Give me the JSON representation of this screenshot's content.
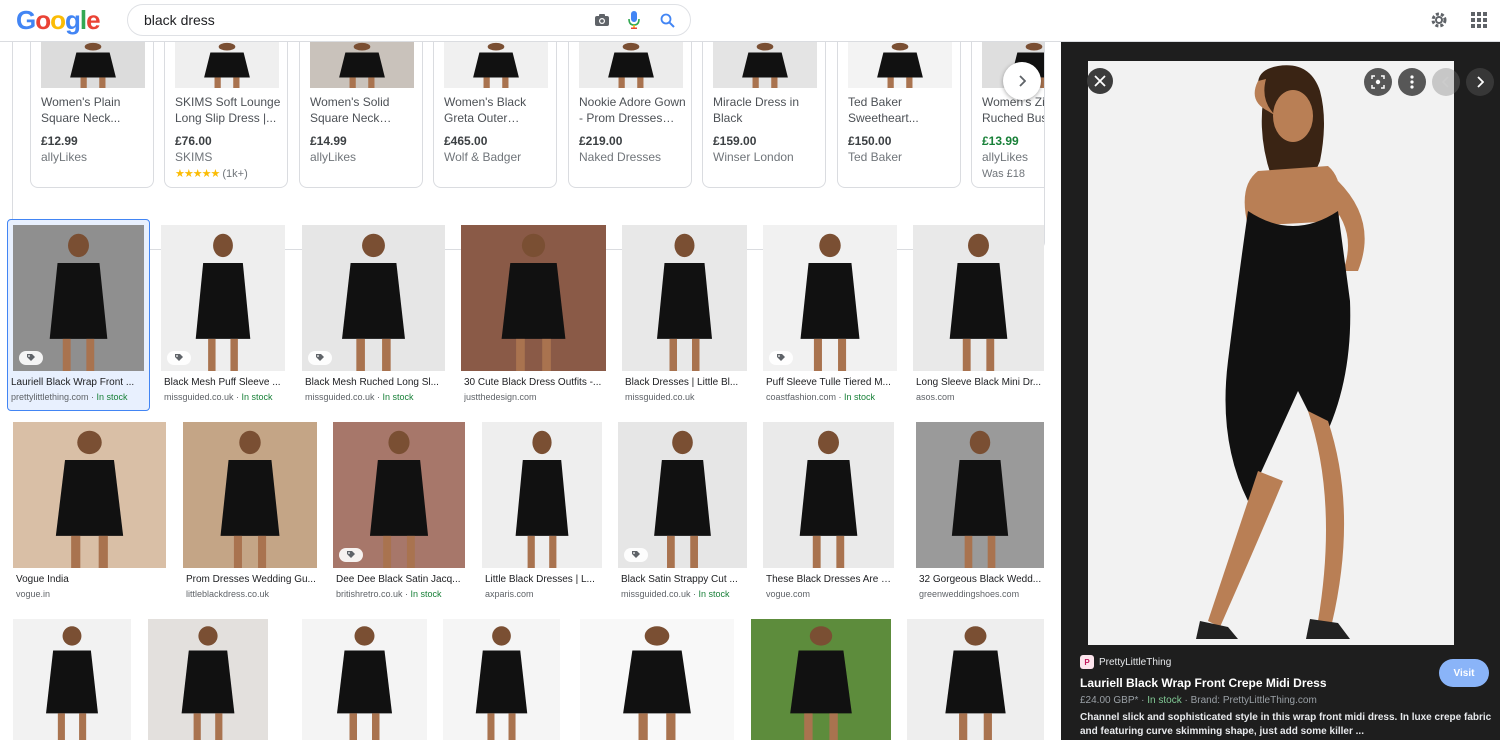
{
  "header": {
    "logo_letters": [
      {
        "ch": "G",
        "color": "#4285f4"
      },
      {
        "ch": "o",
        "color": "#ea4335"
      },
      {
        "ch": "o",
        "color": "#fbbc05"
      },
      {
        "ch": "g",
        "color": "#4285f4"
      },
      {
        "ch": "l",
        "color": "#34a853"
      },
      {
        "ch": "e",
        "color": "#ea4335"
      }
    ],
    "search_value": "black dress",
    "icons": [
      "camera-icon",
      "microphone-icon",
      "search-icon",
      "gear-icon",
      "apps-grid-icon"
    ]
  },
  "shopping": [
    {
      "title": "Women's Plain Square Neck...",
      "price": "£12.99",
      "seller": "allyLikes",
      "img": "#dcdcdc"
    },
    {
      "title": "SKIMS Soft Lounge Long Slip Dress |...",
      "price": "£76.00",
      "seller": "SKIMS",
      "rating_stars": "★★★★★",
      "rating_count": "(1k+)",
      "img": "#efefef"
    },
    {
      "title": "Women's Solid Square Neck Long...",
      "price": "£14.99",
      "seller": "allyLikes",
      "img": "#c9c2bb"
    },
    {
      "title": "Women's Black Greta Outer Space...",
      "price": "£465.00",
      "seller": "Wolf & Badger",
      "img": "#f0f0f0"
    },
    {
      "title": "Nookie Adore Gown - Prom Dresses an...",
      "price": "£219.00",
      "seller": "Naked Dresses",
      "img": "#ececec"
    },
    {
      "title": "Miracle Dress in Black",
      "price": "£159.00",
      "seller": "Winser London",
      "img": "#e4e4e4"
    },
    {
      "title": "Ted Baker Sweetheart...",
      "price": "£150.00",
      "seller": "Ted Baker",
      "img": "#f3f3f3"
    },
    {
      "title": "Women's Zip Ruched Bust...",
      "price": "£13.99",
      "price_sale": true,
      "seller": "allyLikes",
      "was": "Was £18",
      "img": "#dedede"
    }
  ],
  "grid": {
    "row1": [
      {
        "title": "Lauriell Black Wrap Front ...",
        "source": "prettylittlething.com",
        "stock": "In stock",
        "tag": true,
        "bg": "#8f8f8f",
        "selected": true
      },
      {
        "title": "Black Mesh Puff Sleeve ...",
        "source": "missguided.co.uk",
        "stock": "In stock",
        "tag": true,
        "bg": "#eeeeee"
      },
      {
        "title": "Black Mesh Ruched Long Sl...",
        "source": "missguided.co.uk",
        "stock": "In stock",
        "tag": true,
        "bg": "#e6e6e6"
      },
      {
        "title": "30 Cute Black Dress Outfits -...",
        "source": "justthedesign.com",
        "stock": "",
        "tag": false,
        "bg": "#8a5a47"
      },
      {
        "title": "Black Dresses | Little Bl...",
        "source": "missguided.co.uk",
        "stock": "",
        "tag": false,
        "bg": "#e8e8e8"
      },
      {
        "title": "Puff Sleeve Tulle Tiered M...",
        "source": "coastfashion.com",
        "stock": "In stock",
        "tag": true,
        "bg": "#f1f1f1"
      },
      {
        "title": "Long Sleeve Black Mini Dr...",
        "source": "asos.com",
        "stock": "",
        "tag": false,
        "bg": "#e9e9e9"
      }
    ],
    "row2": [
      {
        "title": "Vogue India",
        "source": "vogue.in",
        "stock": "",
        "tag": false,
        "bg": "#d9bfa6"
      },
      {
        "title": "Prom Dresses Wedding Gu...",
        "source": "littleblackdress.co.uk",
        "stock": "",
        "tag": false,
        "bg": "#c4a586"
      },
      {
        "title": "Dee Dee Black Satin Jacq...",
        "source": "britishretro.co.uk",
        "stock": "In stock",
        "tag": true,
        "bg": "#a7776a"
      },
      {
        "title": "Little Black Dresses | L...",
        "source": "axparis.com",
        "stock": "",
        "tag": false,
        "bg": "#eeeeee"
      },
      {
        "title": "Black Satin Strappy Cut ...",
        "source": "missguided.co.uk",
        "stock": "In stock",
        "tag": true,
        "bg": "#e6e6e6"
      },
      {
        "title": "These Black Dresses Are P...",
        "source": "vogue.com",
        "stock": "",
        "tag": false,
        "bg": "#eaeaea"
      },
      {
        "title": "32 Gorgeous Black Wedd...",
        "source": "greenweddingshoes.com",
        "stock": "",
        "tag": false,
        "bg": "#9a9a9a"
      }
    ],
    "row3": [
      {
        "bg": "#f2f2f2"
      },
      {
        "bg": "#e3e0dd"
      },
      {
        "bg": "#f4f4f4"
      },
      {
        "bg": "#f5f5f5"
      },
      {
        "bg": "#f8f8f8"
      },
      {
        "bg": "#5d8c3c"
      },
      {
        "bg": "#eeeeee"
      }
    ]
  },
  "panel": {
    "source": "PrettyLittleThing",
    "favicon_letter": "P",
    "title": "Lauriell Black Wrap Front Crepe Midi Dress",
    "price": "£24.00 GBP*",
    "stock": "In stock",
    "brand": "Brand: PrettyLittleThing.com",
    "description": "Channel slick and sophisticated style in this wrap front midi dress. In luxe crepe fabric and featuring curve skimming shape, just add some killer ...",
    "visit_label": "Visit"
  }
}
